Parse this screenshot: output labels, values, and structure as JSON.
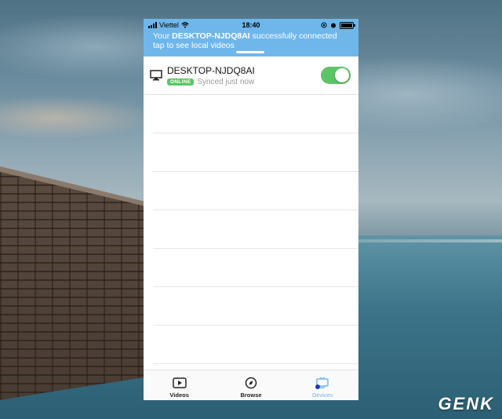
{
  "status": {
    "carrier": "Viettel",
    "time": "18:40"
  },
  "banner": {
    "prefix": "Your ",
    "device": "DESKTOP-NJDQ8AI",
    "suffix": " successfully connected",
    "line2": "tap to see local videos"
  },
  "device": {
    "name": "DESKTOP-NJDQ8AI",
    "badge": "ONLINE",
    "sync_status": "Synced just now",
    "enabled": true
  },
  "tabs": [
    {
      "label": "Videos",
      "icon": "play-icon"
    },
    {
      "label": "Browse",
      "icon": "compass-icon"
    },
    {
      "label": "Devices",
      "icon": "tv-icon"
    }
  ],
  "watermark": "GENK",
  "colors": {
    "accent": "#6fb7eb",
    "online": "#5cc466"
  }
}
